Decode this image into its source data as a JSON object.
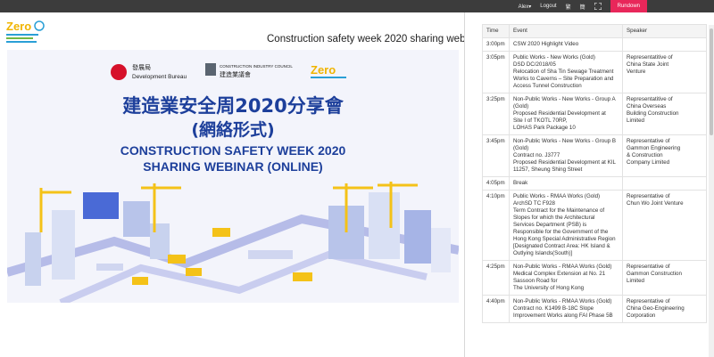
{
  "topbar": {
    "user": "Alex",
    "logout": "Logout",
    "lang1": "繁",
    "lang2": "簡",
    "rundown": "Rundown"
  },
  "header": {
    "title": "Construction safety week 2020 sharing webinar"
  },
  "poster": {
    "org1_cn": "發展局",
    "org1_en": "Development Bureau",
    "org2_en": "CONSTRUCTION INDUSTRY COUNCIL",
    "org2_cn": "建造業議會",
    "zero_logo": "Zero",
    "title_cn1": "建造業安全周2020分享會",
    "title_cn2": "(網絡形式)",
    "title_en1": "CONSTRUCTION SAFETY WEEK 2020",
    "title_en2": "SHARING WEBINAR (ONLINE)",
    "colors": {
      "title_blue": "#1d3f9b",
      "bg_light": "#eef0fa",
      "yellow": "#f4c218",
      "road": "#b6bce8"
    }
  },
  "logo": {
    "text": "Zero"
  },
  "rundown": {
    "headers": [
      "Time",
      "Event",
      "Speaker"
    ],
    "rows": [
      {
        "time": "3:00pm",
        "event": [
          "CSW 2020 Highlight Video"
        ],
        "speaker": []
      },
      {
        "time": "3:05pm",
        "event": [
          "Public Works - New Works (Gold)",
          "DSD DC/2018/05",
          "Relocation of Sha Tin Sewage Treatment",
          "Works to Caverns – Site Preparation and",
          "Access Tunnel Construction"
        ],
        "speaker": [
          "Representatitive of",
          "China State Joint",
          "Venture"
        ]
      },
      {
        "time": "3:25pm",
        "event": [
          "Non-Public Works - New Works - Group A",
          "(Gold)",
          "Proposed Residential Development at",
          "Site I of TKOTL 70RP,",
          "LOHAS Park Package 10"
        ],
        "speaker": [
          "Representatitive of",
          "China Overseas",
          "Building Construction",
          "Limited"
        ]
      },
      {
        "time": "3:45pm",
        "event": [
          "Non-Public Works - New Works - Group B",
          "(Gold)",
          "Contract no. J3777",
          "Proposed Residential Development at KIL",
          "11257, Sheung Shing Street"
        ],
        "speaker": [
          "Representative of",
          "Gammon Engineering",
          "& Construction",
          "Company Limited"
        ]
      },
      {
        "time": "4:05pm",
        "event": [
          "Break"
        ],
        "speaker": []
      },
      {
        "time": "4:10pm",
        "event": [
          "Public Works - RMAA Works (Gold)",
          "ArchSD TC F928",
          "Term Contract for the Maintenance of",
          "Slopes for which the Architectural",
          "Services Department (PSB) is",
          "Responsible for the Government of the",
          "Hong Kong Special Administrative Region",
          "[Designated Contract Area: HK Island &",
          "Outlying Islands(South)]"
        ],
        "speaker": [
          "Representative of",
          "Chun Wo Joint Venture"
        ]
      },
      {
        "time": "4:25pm",
        "event": [
          "Non-Public Works - RMAA Works (Gold)",
          "Medical Complex Extension at No. 21",
          "Sassoon Road for",
          "The University of Hong Kong"
        ],
        "speaker": [
          "Representative of",
          "Gammon Construction",
          "Limited"
        ]
      },
      {
        "time": "4:40pm",
        "event": [
          "Non-Public Works - RMAA Works (Gold)",
          "Contract no. K1499 B-18C Slope",
          "Improvement Works along FAI Phase 5B"
        ],
        "speaker": [
          "Representative of",
          "China Geo-Engineering",
          "Corporation"
        ]
      }
    ]
  }
}
